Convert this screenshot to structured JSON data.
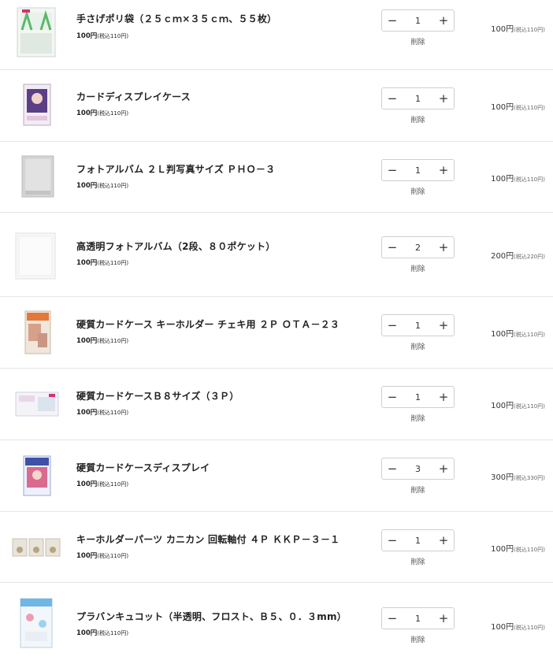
{
  "labels": {
    "delete": "削除"
  },
  "items": [
    {
      "name": "手さげポリ袋（２５ｃｍ×３５ｃｍ、５５枚）",
      "price": "100円",
      "price_tax": "(税込110円)",
      "qty": "1",
      "subtotal": "100円",
      "subtotal_tax": "(税込110円)"
    },
    {
      "name": "カードディスプレイケース",
      "price": "100円",
      "price_tax": "(税込110円)",
      "qty": "1",
      "subtotal": "100円",
      "subtotal_tax": "(税込110円)"
    },
    {
      "name": "フォトアルバム ２Ｌ判写真サイズ ＰＨＯ－３",
      "price": "100円",
      "price_tax": "(税込110円)",
      "qty": "1",
      "subtotal": "100円",
      "subtotal_tax": "(税込110円)"
    },
    {
      "name": "高透明フォトアルバム（2段、８０ポケット）",
      "price": "100円",
      "price_tax": "(税込110円)",
      "qty": "2",
      "subtotal": "200円",
      "subtotal_tax": "(税込220円)"
    },
    {
      "name": "硬質カードケース キーホルダー チェキ用 ２Ｐ ＯＴＡ－２３",
      "price": "100円",
      "price_tax": "(税込110円)",
      "qty": "1",
      "subtotal": "100円",
      "subtotal_tax": "(税込110円)"
    },
    {
      "name": "硬質カードケースＢ８サイズ（３Ｐ）",
      "price": "100円",
      "price_tax": "(税込110円)",
      "qty": "1",
      "subtotal": "100円",
      "subtotal_tax": "(税込110円)"
    },
    {
      "name": "硬質カードケースディスプレイ",
      "price": "100円",
      "price_tax": "(税込110円)",
      "qty": "3",
      "subtotal": "300円",
      "subtotal_tax": "(税込330円)"
    },
    {
      "name": "キーホルダーパーツ カニカン 回転軸付 ４Ｐ ＫＫＰ－３－１",
      "price": "100円",
      "price_tax": "(税込110円)",
      "qty": "1",
      "subtotal": "100円",
      "subtotal_tax": "(税込110円)"
    },
    {
      "name": "プラバンキュコット（半透明、フロスト、Ｂ５、０．３mm）",
      "price": "100円",
      "price_tax": "(税込110円)",
      "qty": "1",
      "subtotal": "100円",
      "subtotal_tax": "(税込110円)"
    }
  ],
  "icons": {
    "minus": "minus-icon",
    "plus": "plus-icon"
  },
  "colors": {
    "divider": "#e6e6e6",
    "stepper_border": "#cfcfcf"
  }
}
